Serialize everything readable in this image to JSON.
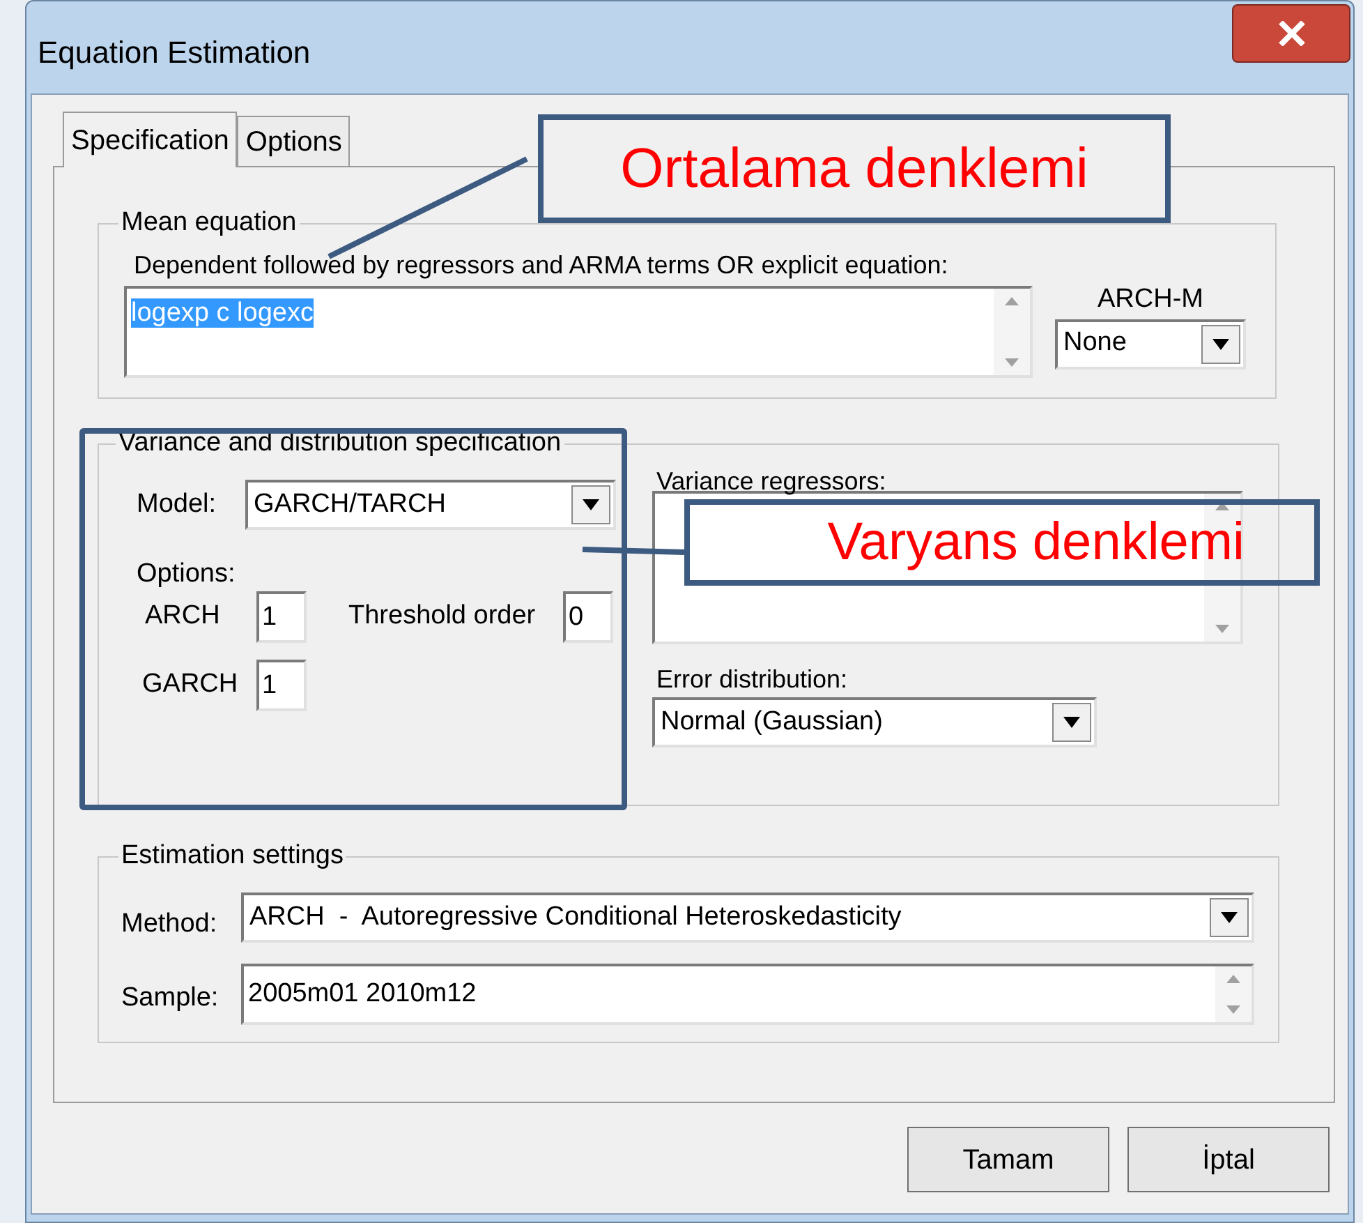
{
  "window": {
    "title": "Equation Estimation"
  },
  "tabs": [
    {
      "label": "Specification",
      "selected": true
    },
    {
      "label": "Options",
      "selected": false
    }
  ],
  "mean_equation": {
    "title": "Mean equation",
    "description": "Dependent followed by regressors and ARMA terms OR explicit equation:",
    "value": "logexp c logexc",
    "value_selected": true,
    "archm_label": "ARCH-M",
    "archm_value": "None"
  },
  "variance": {
    "title": "Variance and distribution specification",
    "model_label": "Model:",
    "model_value": "GARCH/TARCH",
    "options_label": "Options:",
    "arch_label": "ARCH",
    "arch_value": "1",
    "threshold_label": "Threshold order",
    "threshold_value": "0",
    "garch_label": "GARCH",
    "garch_value": "1",
    "regressors_label": "Variance regressors:",
    "error_label": "Error distribution:",
    "error_value": "Normal (Gaussian)"
  },
  "estimation": {
    "title": "Estimation settings",
    "method_label": "Method:",
    "method_value": "ARCH  -  Autoregressive Conditional Heteroskedasticity",
    "sample_label": "Sample:",
    "sample_value": "2005m01 2010m12"
  },
  "buttons": [
    "Tamam",
    "İptal"
  ],
  "annotations": [
    {
      "text": "Ortalama denklemi"
    },
    {
      "text": "Varyans denklemi"
    }
  ]
}
